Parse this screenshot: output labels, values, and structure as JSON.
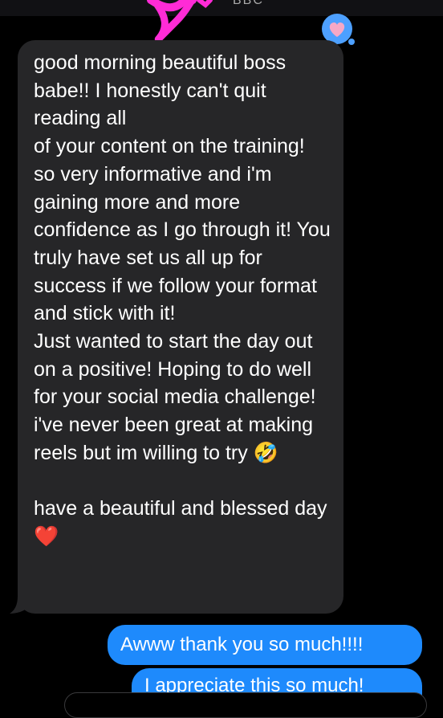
{
  "header": {
    "contact_name": "BBC"
  },
  "reaction": {
    "icon": "heart-icon",
    "color": "#f6a8c6",
    "bubble_color": "#4da0ff"
  },
  "messages": {
    "incoming": {
      "text": "good morning beautiful boss babe!! I honestly can't quit reading all\nof your content on the training! so very informative and i'm gaining more and more confidence as I go through it! You truly have set us all up for success if we follow your format and stick with it!\nJust wanted to start the day out on a positive! Hoping to do well for your social media challenge! i've never been great at making reels but im willing to try 🤣\n\nhave a beautiful and blessed day ❤️",
      "background": "#262628"
    },
    "outgoing": [
      {
        "text": "Awww thank you so much!!!!"
      },
      {
        "text": "I appreciate this so much!"
      }
    ],
    "outgoing_color": "#1e8afc"
  }
}
